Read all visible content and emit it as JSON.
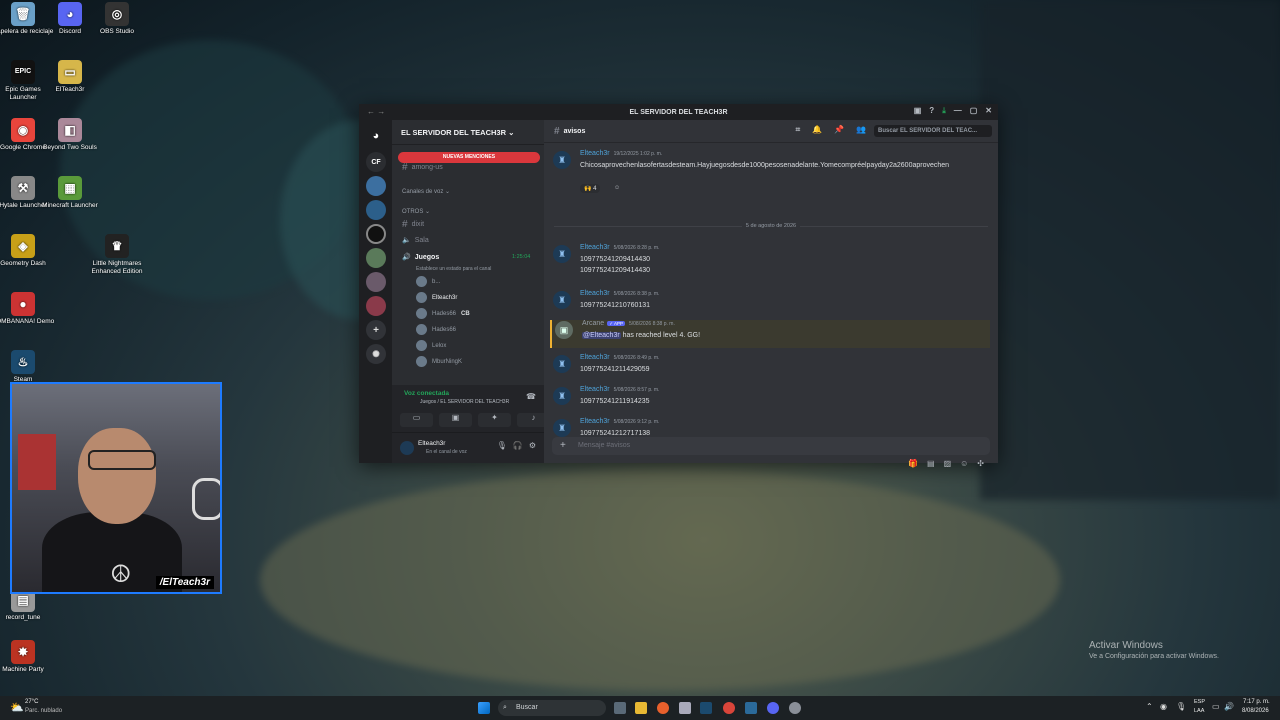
{
  "desktop": {
    "icons": [
      {
        "label": "Papelera de reciclaje",
        "glyph": "🗑"
      },
      {
        "label": "Discord",
        "glyph": "◕"
      },
      {
        "label": "OBS Studio",
        "glyph": "◎"
      },
      {
        "label": "Epic Games Launcher",
        "glyph": "EPIC"
      },
      {
        "label": "ElTeach3r",
        "glyph": "▭"
      },
      {
        "label": "Google Chrome",
        "glyph": "◉"
      },
      {
        "label": "Beyond Two Souls",
        "glyph": "◧"
      },
      {
        "label": "Hytale Launcher",
        "glyph": "⚒"
      },
      {
        "label": "Minecraft Launcher",
        "glyph": "▦"
      },
      {
        "label": "Geometry Dash",
        "glyph": "◈"
      },
      {
        "label": "Little Nightmares Enhanced Edition",
        "glyph": "♛"
      },
      {
        "label": "BOMBANANA! Demo",
        "glyph": "●"
      },
      {
        "label": "Steam",
        "glyph": "♨"
      },
      {
        "label": "record_tune",
        "glyph": "▤"
      },
      {
        "label": "Machine Party",
        "glyph": "✸"
      }
    ]
  },
  "webcam": {
    "tag": "/ElTeach3r"
  },
  "window": {
    "title": "EL SERVIDOR DEL TEACH3R"
  },
  "guilds": {
    "cf_label": "CF",
    "badges": [
      "27"
    ]
  },
  "server": {
    "name": "EL SERVIDOR DEL TEACH3R",
    "mentions": "NUEVAS MENCIONES",
    "channel_among": "among-us",
    "cat_voice": "Canales de voz",
    "cat_otros": "OTROS",
    "ch_dixit": "dixit",
    "ch_sala": "Sala",
    "ch_juegos": "Juegos",
    "juegos_time": "1:25:04",
    "juegos_status": "Establece un estado para el canal",
    "users": [
      "b...",
      "Elteach3r",
      "Hades66",
      "Hades66",
      "Lelox",
      "MburNingK"
    ],
    "user_badge": "CB"
  },
  "voice": {
    "status": "Voz conectada",
    "location": "Juegos / EL SERVIDOR DEL TEACH3R"
  },
  "account": {
    "name": "Elteach3r",
    "status": "En el canal de voz"
  },
  "channel": {
    "name": "avisos",
    "search_placeholder": "Buscar EL SERVIDOR DEL TEAC..."
  },
  "messages": [
    {
      "author": "Elteach3r",
      "time": "19/12/2025 1:02 p. m.",
      "text": "Chicos aprovechen las ofertas de steam. Hay juegos desde 1000 pesos en adelante. Yo me compré el payday 2 a 2600 aprovechen",
      "reaction": "4"
    },
    {
      "divider": "5 de agosto de 2026"
    },
    {
      "author": "Elteach3r",
      "time": "5/08/2026 8:28 p. m.",
      "text": "1097752412094 14430",
      "text2": "109775241209414430"
    },
    {
      "author": "Elteach3r",
      "time": "5/08/2026 8:38 p. m.",
      "text": "1097752412107 60131"
    },
    {
      "author": "Arcane",
      "app": "APP",
      "time": "5/08/2026 8:38 p. m.",
      "mention": "@Elteach3r",
      "text": "has reached level 4. GG!"
    },
    {
      "author": "Elteach3r",
      "time": "5/08/2026 8:49 p. m.",
      "text": "1097752412114 29059"
    },
    {
      "author": "Elteach3r",
      "time": "5/08/2026 8:57 p. m.",
      "text": "1097752412119 14235"
    },
    {
      "author": "Elteach3r",
      "time": "5/08/2026 9:12 p. m.",
      "text": "1097752412127 17138"
    }
  ],
  "composer": {
    "placeholder": "Mensaje #avisos"
  },
  "activate": {
    "title": "Activar Windows",
    "subtitle": "Ve a Configuración para activar Windows."
  },
  "taskbar": {
    "weather_temp": "27°C",
    "weather_desc": "Parc. nublado",
    "search": "Buscar",
    "lang1": "ESP",
    "lang2": "LAA",
    "time": "7:17 p. m.",
    "date": "8/08/2026"
  }
}
